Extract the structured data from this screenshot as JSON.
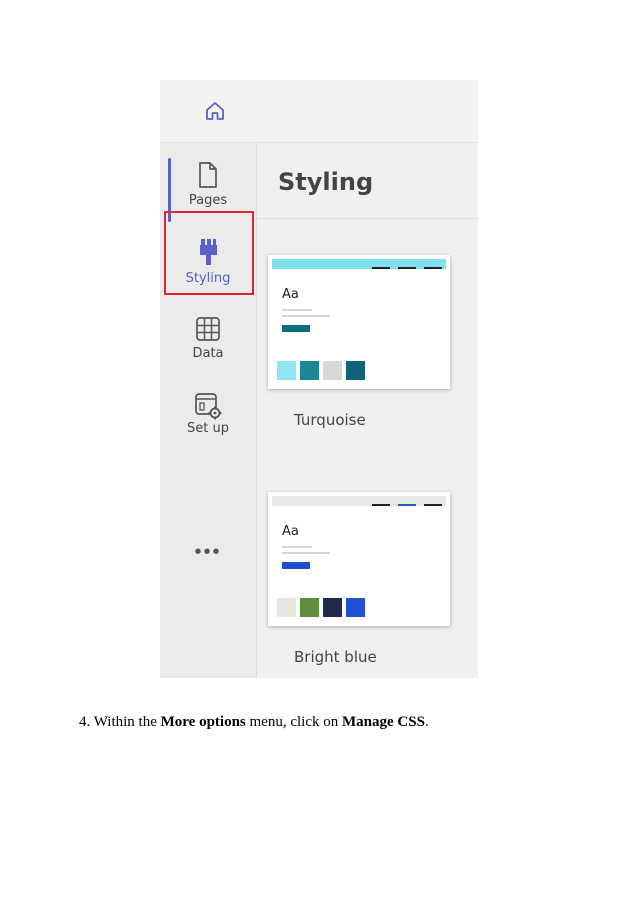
{
  "nav": {
    "home_icon": "home-icon",
    "items": [
      {
        "label": "Pages",
        "icon": "page-icon"
      },
      {
        "label": "Styling",
        "icon": "paintbrush-icon",
        "active": true
      },
      {
        "label": "Data",
        "icon": "table-icon"
      },
      {
        "label": "Set up",
        "icon": "setup-gear-icon"
      }
    ],
    "more_icon": "ellipsis-icon"
  },
  "panel": {
    "title": "Styling",
    "themes": [
      {
        "name": "Turquoise",
        "header_color": "#7fe1ee",
        "dash_colors": [
          "#222222",
          "#222222",
          "#222222"
        ],
        "accent_color": "#0e6d7c",
        "swatches": [
          "#8ee6f2",
          "#1b8797",
          "#d8d8d8",
          "#0e6378"
        ]
      },
      {
        "name": "Bright blue",
        "header_color": "#e8e8e2",
        "dash_colors": [
          "#222222",
          "#2359c9",
          "#222222"
        ],
        "accent_color": "#1f4fcc",
        "swatches": [
          "#e6e6df",
          "#5e8d3c",
          "#1e2a48",
          "#1f50d1"
        ]
      }
    ]
  },
  "instruction": {
    "prefix": "4. Within the ",
    "bold1": "More options",
    "middle": " menu, click on ",
    "bold2": "Manage CSS",
    "suffix": "."
  },
  "colors": {
    "accent": "#5b5fc7",
    "highlight": "#e0262d"
  }
}
